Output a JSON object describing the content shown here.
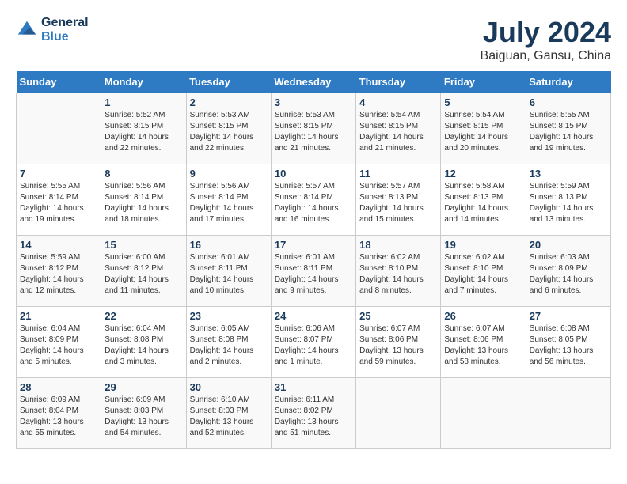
{
  "header": {
    "logo_line1": "General",
    "logo_line2": "Blue",
    "month": "July 2024",
    "location": "Baiguan, Gansu, China"
  },
  "days_of_week": [
    "Sunday",
    "Monday",
    "Tuesday",
    "Wednesday",
    "Thursday",
    "Friday",
    "Saturday"
  ],
  "weeks": [
    [
      {
        "day": "",
        "info": ""
      },
      {
        "day": "1",
        "info": "Sunrise: 5:52 AM\nSunset: 8:15 PM\nDaylight: 14 hours\nand 22 minutes."
      },
      {
        "day": "2",
        "info": "Sunrise: 5:53 AM\nSunset: 8:15 PM\nDaylight: 14 hours\nand 22 minutes."
      },
      {
        "day": "3",
        "info": "Sunrise: 5:53 AM\nSunset: 8:15 PM\nDaylight: 14 hours\nand 21 minutes."
      },
      {
        "day": "4",
        "info": "Sunrise: 5:54 AM\nSunset: 8:15 PM\nDaylight: 14 hours\nand 21 minutes."
      },
      {
        "day": "5",
        "info": "Sunrise: 5:54 AM\nSunset: 8:15 PM\nDaylight: 14 hours\nand 20 minutes."
      },
      {
        "day": "6",
        "info": "Sunrise: 5:55 AM\nSunset: 8:15 PM\nDaylight: 14 hours\nand 19 minutes."
      }
    ],
    [
      {
        "day": "7",
        "info": "Sunrise: 5:55 AM\nSunset: 8:14 PM\nDaylight: 14 hours\nand 19 minutes."
      },
      {
        "day": "8",
        "info": "Sunrise: 5:56 AM\nSunset: 8:14 PM\nDaylight: 14 hours\nand 18 minutes."
      },
      {
        "day": "9",
        "info": "Sunrise: 5:56 AM\nSunset: 8:14 PM\nDaylight: 14 hours\nand 17 minutes."
      },
      {
        "day": "10",
        "info": "Sunrise: 5:57 AM\nSunset: 8:14 PM\nDaylight: 14 hours\nand 16 minutes."
      },
      {
        "day": "11",
        "info": "Sunrise: 5:57 AM\nSunset: 8:13 PM\nDaylight: 14 hours\nand 15 minutes."
      },
      {
        "day": "12",
        "info": "Sunrise: 5:58 AM\nSunset: 8:13 PM\nDaylight: 14 hours\nand 14 minutes."
      },
      {
        "day": "13",
        "info": "Sunrise: 5:59 AM\nSunset: 8:13 PM\nDaylight: 14 hours\nand 13 minutes."
      }
    ],
    [
      {
        "day": "14",
        "info": "Sunrise: 5:59 AM\nSunset: 8:12 PM\nDaylight: 14 hours\nand 12 minutes."
      },
      {
        "day": "15",
        "info": "Sunrise: 6:00 AM\nSunset: 8:12 PM\nDaylight: 14 hours\nand 11 minutes."
      },
      {
        "day": "16",
        "info": "Sunrise: 6:01 AM\nSunset: 8:11 PM\nDaylight: 14 hours\nand 10 minutes."
      },
      {
        "day": "17",
        "info": "Sunrise: 6:01 AM\nSunset: 8:11 PM\nDaylight: 14 hours\nand 9 minutes."
      },
      {
        "day": "18",
        "info": "Sunrise: 6:02 AM\nSunset: 8:10 PM\nDaylight: 14 hours\nand 8 minutes."
      },
      {
        "day": "19",
        "info": "Sunrise: 6:02 AM\nSunset: 8:10 PM\nDaylight: 14 hours\nand 7 minutes."
      },
      {
        "day": "20",
        "info": "Sunrise: 6:03 AM\nSunset: 8:09 PM\nDaylight: 14 hours\nand 6 minutes."
      }
    ],
    [
      {
        "day": "21",
        "info": "Sunrise: 6:04 AM\nSunset: 8:09 PM\nDaylight: 14 hours\nand 5 minutes."
      },
      {
        "day": "22",
        "info": "Sunrise: 6:04 AM\nSunset: 8:08 PM\nDaylight: 14 hours\nand 3 minutes."
      },
      {
        "day": "23",
        "info": "Sunrise: 6:05 AM\nSunset: 8:08 PM\nDaylight: 14 hours\nand 2 minutes."
      },
      {
        "day": "24",
        "info": "Sunrise: 6:06 AM\nSunset: 8:07 PM\nDaylight: 14 hours\nand 1 minute."
      },
      {
        "day": "25",
        "info": "Sunrise: 6:07 AM\nSunset: 8:06 PM\nDaylight: 13 hours\nand 59 minutes."
      },
      {
        "day": "26",
        "info": "Sunrise: 6:07 AM\nSunset: 8:06 PM\nDaylight: 13 hours\nand 58 minutes."
      },
      {
        "day": "27",
        "info": "Sunrise: 6:08 AM\nSunset: 8:05 PM\nDaylight: 13 hours\nand 56 minutes."
      }
    ],
    [
      {
        "day": "28",
        "info": "Sunrise: 6:09 AM\nSunset: 8:04 PM\nDaylight: 13 hours\nand 55 minutes."
      },
      {
        "day": "29",
        "info": "Sunrise: 6:09 AM\nSunset: 8:03 PM\nDaylight: 13 hours\nand 54 minutes."
      },
      {
        "day": "30",
        "info": "Sunrise: 6:10 AM\nSunset: 8:03 PM\nDaylight: 13 hours\nand 52 minutes."
      },
      {
        "day": "31",
        "info": "Sunrise: 6:11 AM\nSunset: 8:02 PM\nDaylight: 13 hours\nand 51 minutes."
      },
      {
        "day": "",
        "info": ""
      },
      {
        "day": "",
        "info": ""
      },
      {
        "day": "",
        "info": ""
      }
    ]
  ]
}
